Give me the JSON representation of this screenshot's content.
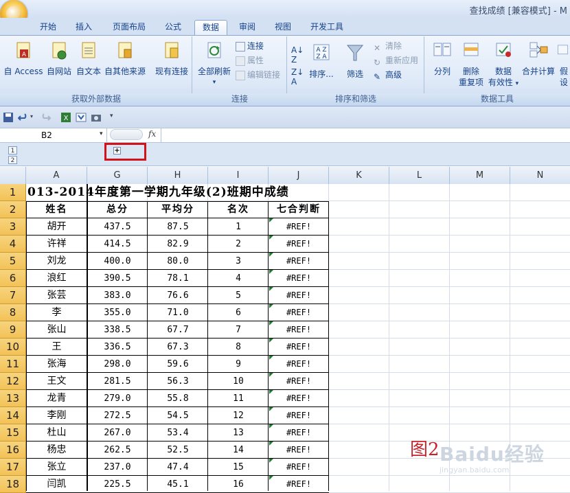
{
  "window": {
    "title": "查找成绩 [兼容模式] - M"
  },
  "tabs": [
    "开始",
    "插入",
    "页面布局",
    "公式",
    "数据",
    "审阅",
    "视图",
    "开发工具"
  ],
  "active_tab": "数据",
  "ribbon": {
    "groups": {
      "external": {
        "label": "获取外部数据",
        "buttons": [
          "自 Access",
          "自网站",
          "自文本",
          "自其他来源",
          "现有连接"
        ]
      },
      "connections": {
        "label": "连接",
        "refresh": "全部刷新",
        "connect": "连接",
        "properties": "属性",
        "edit_links": "编辑链接"
      },
      "sortfilter": {
        "label": "排序和筛选",
        "sort": "排序...",
        "filter": "筛选",
        "clear": "清除",
        "reapply": "重新应用",
        "advanced": "高级"
      },
      "datatools": {
        "label": "数据工具",
        "split": "分列",
        "remove_dup_1": "删除",
        "remove_dup_2": "重复项",
        "validation_1": "数据",
        "validation_2": "有效性",
        "consolidate": "合并计算",
        "whatif": "假设"
      }
    }
  },
  "name_box": "B2",
  "formula": "",
  "fx_label": "fx",
  "outline_levels": [
    "1",
    "2"
  ],
  "expand_symbol": "+",
  "columns": [
    "A",
    "G",
    "H",
    "I",
    "J",
    "K",
    "L",
    "M",
    "N"
  ],
  "rows": [
    "1",
    "2",
    "3",
    "4",
    "5",
    "6",
    "7",
    "8",
    "9",
    "10",
    "11",
    "12",
    "13",
    "14",
    "15",
    "16",
    "17",
    "18"
  ],
  "sheet_title": "013-2014年度第一学期九年级(2)班期中成绩",
  "table_headers": [
    "姓名",
    "总分",
    "平均分",
    "名次",
    "七合判断"
  ],
  "table_rows": [
    [
      "胡开",
      "437.5",
      "87.5",
      "1",
      "#REF!"
    ],
    [
      "许祥",
      "414.5",
      "82.9",
      "2",
      "#REF!"
    ],
    [
      "刘龙",
      "400.0",
      "80.0",
      "3",
      "#REF!"
    ],
    [
      "浪红",
      "390.5",
      "78.1",
      "4",
      "#REF!"
    ],
    [
      "张芸",
      "383.0",
      "76.6",
      "5",
      "#REF!"
    ],
    [
      "李",
      "355.0",
      "71.0",
      "6",
      "#REF!"
    ],
    [
      "张山",
      "338.5",
      "67.7",
      "7",
      "#REF!"
    ],
    [
      "王",
      "336.5",
      "67.3",
      "8",
      "#REF!"
    ],
    [
      "张海",
      "298.0",
      "59.6",
      "9",
      "#REF!"
    ],
    [
      "王文",
      "281.5",
      "56.3",
      "10",
      "#REF!"
    ],
    [
      "龙青",
      "279.0",
      "55.8",
      "11",
      "#REF!"
    ],
    [
      "李刚",
      "272.5",
      "54.5",
      "12",
      "#REF!"
    ],
    [
      "杜山",
      "267.0",
      "53.4",
      "13",
      "#REF!"
    ],
    [
      "杨忠",
      "262.5",
      "52.5",
      "14",
      "#REF!"
    ],
    [
      "张立",
      "237.0",
      "47.4",
      "15",
      "#REF!"
    ],
    [
      "闫凯",
      "225.5",
      "45.1",
      "16",
      "#REF!"
    ]
  ],
  "figure_label": "图2",
  "watermark": {
    "brand": "Baidu经验",
    "url": "jingyan.baidu.com"
  }
}
